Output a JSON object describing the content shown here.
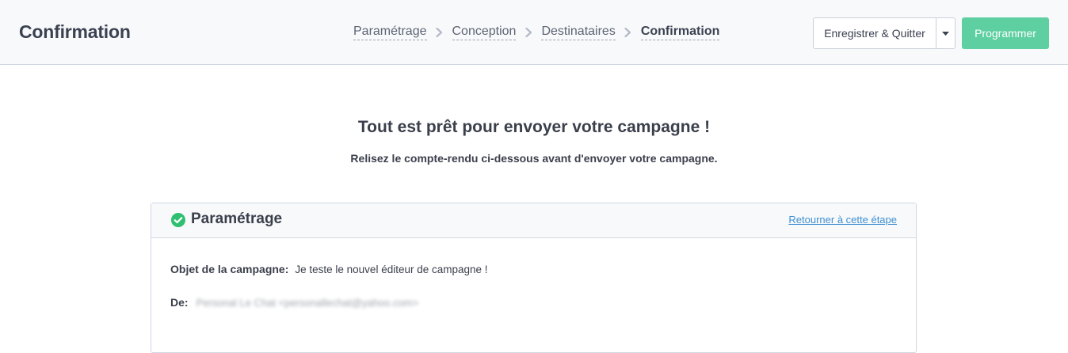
{
  "header": {
    "title": "Confirmation",
    "breadcrumb": [
      {
        "label": "Paramétrage"
      },
      {
        "label": "Conception"
      },
      {
        "label": "Destinataires"
      },
      {
        "label": "Confirmation",
        "active": true
      }
    ],
    "save_label": "Enregistrer & Quitter",
    "program_label": "Programmer"
  },
  "main": {
    "headline": "Tout est prêt pour envoyer votre campagne !",
    "subline": "Relisez le compte-rendu ci-dessous avant d'envoyer votre campagne."
  },
  "card": {
    "title": "Paramétrage",
    "back_link": "Retourner à cette étape",
    "subject_label": "Objet de la campagne:",
    "subject_value": "Je teste le nouvel éditeur de campagne !",
    "from_label": "De:",
    "from_value_blurred": "Personal Le Chat <personallechat@yahoo.com>"
  },
  "colors": {
    "primary": "#5dcfa0",
    "link": "#3f8fd1",
    "success": "#2fbf71",
    "border": "#cfd8e3"
  }
}
